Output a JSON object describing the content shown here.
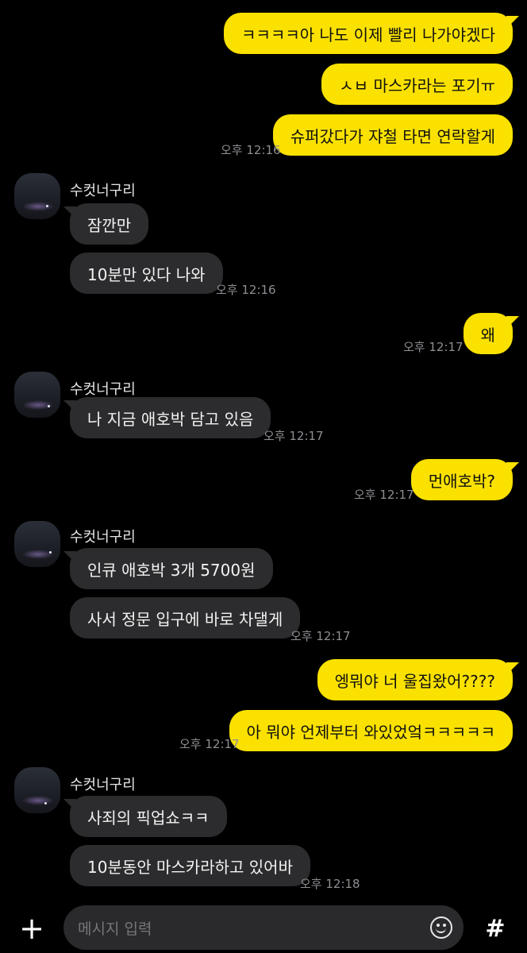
{
  "chat": {
    "contact_name": "수컷너구리",
    "messages": [
      {
        "sender": "me",
        "text": "ㅋㅋㅋㅋ아 나도 이제 빨리 나가야겠다"
      },
      {
        "sender": "me",
        "text": "ㅅㅂ 마스카라는 포기ㅠ"
      },
      {
        "sender": "me",
        "text": "슈퍼갔다가 쟈철 타면 연락할게",
        "time": "오후 12:16"
      },
      {
        "sender": "other",
        "text": "잠깐만"
      },
      {
        "sender": "other",
        "text": "10분만 있다 나와",
        "time": "오후 12:16"
      },
      {
        "sender": "me",
        "text": "왜",
        "time": "오후 12:17"
      },
      {
        "sender": "other",
        "text": "나 지금 애호박 담고 있음",
        "time": "오후 12:17"
      },
      {
        "sender": "me",
        "text": "먼애호박?",
        "time": "오후 12:17"
      },
      {
        "sender": "other",
        "text": "인큐 애호박 3개 5700원"
      },
      {
        "sender": "other",
        "text": "사서 정문 입구에 바로 차댈게",
        "time": "오후 12:17"
      },
      {
        "sender": "me",
        "text": "엥뭐야 너 울집왔어????"
      },
      {
        "sender": "me",
        "text": "아 뭐야 언제부터 와있었엌ㅋㅋㅋㅋㅋ",
        "time": "오후 12:17"
      },
      {
        "sender": "other",
        "text": "사죄의 픽업쇼ㅋㅋ"
      },
      {
        "sender": "other",
        "text": "10분동안 마스카라하고 있어바",
        "time": "오후 12:18"
      }
    ]
  },
  "input_bar": {
    "placeholder": "메시지 입력",
    "plus_icon": "plus-icon",
    "emoji_icon": "emoji-icon",
    "hash_icon": "hash-icon",
    "plus_label": "+",
    "hash_label": "#"
  },
  "colors": {
    "my_bubble": "#fae100",
    "other_bubble": "#2c2c2e",
    "background": "#000000",
    "timestamp": "#8e8e93"
  }
}
